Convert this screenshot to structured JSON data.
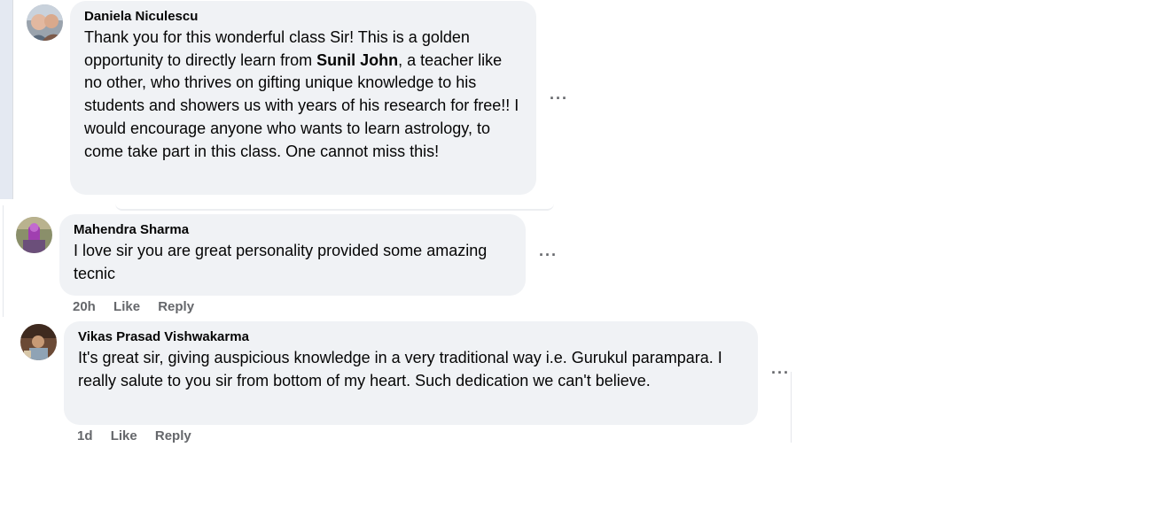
{
  "comments": [
    {
      "author": "Daniela Niculescu",
      "text_before": "Thank you for this wonderful class Sir! This is a golden opportunity to directly learn from ",
      "text_bold": "Sunil John",
      "text_after": ", a teacher like no other, who thrives on gifting unique knowledge to his students and showers us with years of his research for free!! I would encourage anyone who wants to learn astrology, to come take part in this class. One cannot miss this!",
      "more_label": "···"
    },
    {
      "author": "Mahendra Sharma",
      "text": "I love sir you are great personality provided some amazing tecnic",
      "time": "20h",
      "like_label": "Like",
      "reply_label": "Reply",
      "more_label": "···"
    },
    {
      "author": "Vikas Prasad Vishwakarma",
      "text": "It's great sir, giving auspicious knowledge in a very traditional way i.e. Gurukul parampara. I really salute to you sir from bottom of my heart. Such dedication we can't believe.",
      "time": "1d",
      "like_label": "Like",
      "reply_label": "Reply",
      "more_label": "···"
    }
  ]
}
